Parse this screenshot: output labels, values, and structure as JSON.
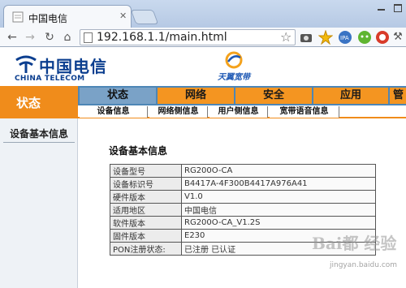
{
  "browser": {
    "tab_title": "中国电信",
    "url": "192.168.1.1/main.html",
    "icons": [
      "back-icon",
      "forward-icon",
      "reload-icon",
      "home-icon",
      "bookmark-star-icon"
    ]
  },
  "brand": {
    "logo_cn": "中国电信",
    "logo_en": "CHINA TELECOM",
    "product": "天翼宽带",
    "colors": {
      "blue": "#0b3e8f",
      "orange": "#f08c1b",
      "nav_blue": "#4d86b6"
    }
  },
  "nav": {
    "section_label": "状态",
    "tabs": [
      "状态",
      "网络",
      "安全",
      "应用",
      "管"
    ],
    "active_tab": "状态",
    "subtabs": [
      "设备信息",
      "网络侧信息",
      "用户侧信息",
      "宽带语音信息"
    ]
  },
  "sidebar": {
    "items": [
      "设备基本信息"
    ]
  },
  "content": {
    "title": "设备基本信息",
    "rows": [
      {
        "key": "设备型号",
        "value": "RG200O-CA"
      },
      {
        "key": "设备标识号",
        "value": "B4417A-4F300B4417A976A41"
      },
      {
        "key": "硬件版本",
        "value": "V1.0"
      },
      {
        "key": "适用地区",
        "value": "中国电信"
      },
      {
        "key": "软件版本",
        "value": "RG200O-CA_V1.2S"
      },
      {
        "key": "固件版本",
        "value": "E230"
      },
      {
        "key": "PON注册状态:",
        "value": "已注册 已认证"
      }
    ]
  },
  "watermark": {
    "text": "Bai都 经验",
    "url": "jingyan.baidu.com"
  }
}
